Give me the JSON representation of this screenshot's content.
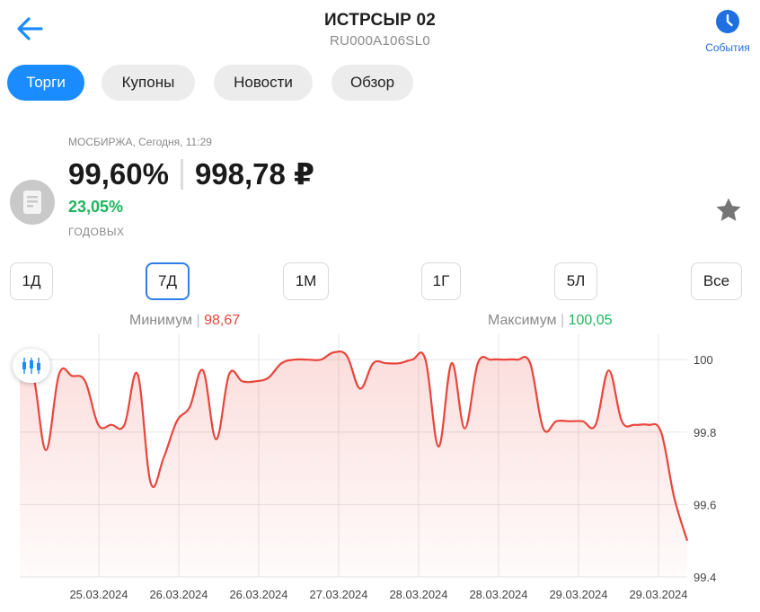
{
  "header": {
    "title": "ИСТРСЫР 02",
    "isin": "RU000A106SL0",
    "events_label": "События"
  },
  "tabs": [
    {
      "label": "Торги",
      "active": true
    },
    {
      "label": "Купоны",
      "active": false
    },
    {
      "label": "Новости",
      "active": false
    },
    {
      "label": "Обзор",
      "active": false
    }
  ],
  "quote": {
    "exchange_time": "МОСБИРЖА, Сегодня, 11:29",
    "price_percent": "99,60%",
    "price_rub": "998,78 ₽",
    "yield": "23,05%",
    "yield_label": "ГОДОВЫХ"
  },
  "periods": [
    {
      "label": "1Д",
      "active": false
    },
    {
      "label": "7Д",
      "active": true
    },
    {
      "label": "1М",
      "active": false
    },
    {
      "label": "1Г",
      "active": false
    },
    {
      "label": "5Л",
      "active": false
    },
    {
      "label": "Все",
      "active": false
    }
  ],
  "stats": {
    "min_label": "Минимум",
    "min_value": "98,67",
    "max_label": "Максимум",
    "max_value": "100,05"
  },
  "colors": {
    "accent": "#1a8cff",
    "line": "#e8453c",
    "positive": "#1bb55c",
    "negative": "#e8453c"
  },
  "chart_data": {
    "type": "area",
    "x_tick_labels": [
      "25.03.2024",
      "26.03.2024",
      "26.03.2024",
      "27.03.2024",
      "28.03.2024",
      "28.03.2024",
      "29.03.2024",
      "29.03.2024"
    ],
    "ylim": [
      99.4,
      100.05
    ],
    "y_ticks": [
      "100",
      "99.8",
      "99.6",
      "99.4"
    ],
    "y_tick_values": [
      100,
      99.8,
      99.6,
      99.4
    ],
    "grid": true,
    "series": [
      {
        "values": [
          99.95,
          99.96,
          99.75,
          99.96,
          99.955,
          99.94,
          99.82,
          99.82,
          99.82,
          99.96,
          99.66,
          99.73,
          99.83,
          99.87,
          99.97,
          99.78,
          99.96,
          99.94,
          99.94,
          99.95,
          99.99,
          100,
          100,
          100,
          100.02,
          100.01,
          99.92,
          99.99,
          99.99,
          99.99,
          100,
          100,
          99.76,
          99.99,
          99.81,
          99.99,
          100,
          100,
          100,
          99.99,
          99.81,
          99.83,
          99.83,
          99.83,
          99.82,
          99.97,
          99.83,
          99.82,
          99.82,
          99.8,
          99.62,
          99.5
        ]
      }
    ]
  }
}
